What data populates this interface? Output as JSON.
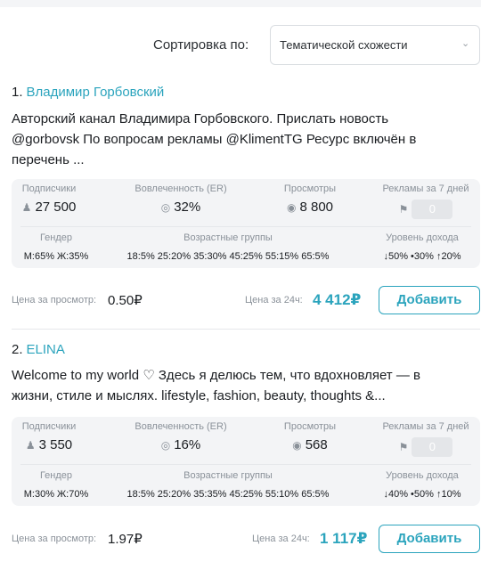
{
  "sort": {
    "label": "Сортировка по:",
    "value": "Тематической схожести"
  },
  "stat_labels": {
    "subscribers": "Подписчики",
    "er": "Вовлеченность (ER)",
    "views": "Просмотры",
    "ads": "Рекламы за 7 дней",
    "gender": "Гендер",
    "age": "Возрастные группы",
    "income": "Уровень дохода"
  },
  "price_labels": {
    "per_view": "Цена за просмотр:",
    "per_24h": "Цена за 24ч:"
  },
  "add_label": "Добавить",
  "channels": [
    {
      "num": "1.",
      "name": "Владимир Горбовский",
      "description": "Авторский канал Владимира Горбовского. Прислать новость @gorbovsk По вопросам рекламы  @KlimentTG  Ресурс включён в перечень ...",
      "subscribers": "27 500",
      "er": "32%",
      "views": "8 800",
      "ads": "0",
      "gender": "М:65%  Ж:35%",
      "age": "18:5%  25:20%  35:30%  45:25%  55:15%  65:5%",
      "income": "↓50%  •30%  ↑20%",
      "price_view": "0.50₽",
      "price_24h": "4 412₽"
    },
    {
      "num": "2.",
      "name": "ELINA",
      "description": "Welcome to my world ♡  Здесь я делюсь тем, что вдохновляет — в жизни, стиле и мыслях.  lifestyle, fashion, beauty, thoughts &...",
      "subscribers": "3 550",
      "er": "16%",
      "views": "568",
      "ads": "0",
      "gender": "М:30%  Ж:70%",
      "age": "18:5%  25:20%  35:35%  45:25%  55:10%  65:5%",
      "income": "↓40%  •50%  ↑10%",
      "price_view": "1.97₽",
      "price_24h": "1 117₽"
    }
  ],
  "icons": {
    "subscribers": "person-icon",
    "er": "er-circle-icon",
    "views": "eye-icon",
    "ads": "tag-icon",
    "sort": "chevron-down-icon"
  },
  "colors": {
    "accent": "#2ba4bd",
    "muted": "#8a9199",
    "panel": "#f3f4f6"
  }
}
